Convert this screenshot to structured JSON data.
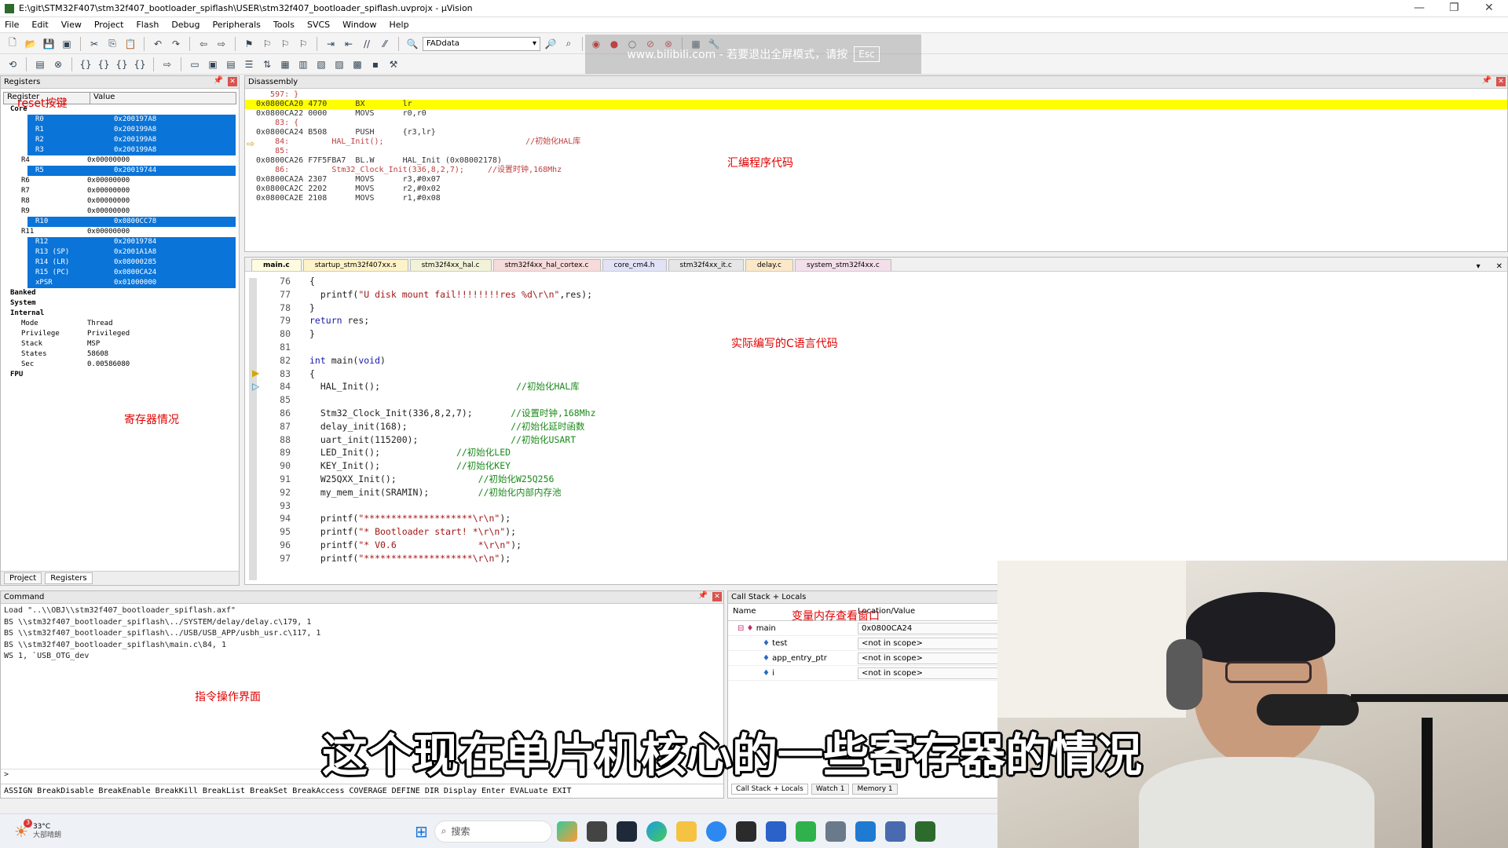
{
  "window": {
    "title": "E:\\git\\STM32F407\\stm32f407_bootloader_spiflash\\USER\\stm32f407_bootloader_spiflash.uvprojx - µVision"
  },
  "menu": [
    "File",
    "Edit",
    "View",
    "Project",
    "Flash",
    "Debug",
    "Peripherals",
    "Tools",
    "SVCS",
    "Window",
    "Help"
  ],
  "toolbar": {
    "combo_value": "FADdata"
  },
  "banner": {
    "text": "www.bilibili.com - 若要退出全屏模式，请按",
    "key": "Esc"
  },
  "registers": {
    "title": "Registers",
    "col_register": "Register",
    "col_value": "Value",
    "rows": [
      {
        "name": "Core",
        "value": "",
        "kind": "top"
      },
      {
        "name": "R0",
        "value": "0x200197A8",
        "kind": "sel"
      },
      {
        "name": "R1",
        "value": "0x200199A8",
        "kind": "sel"
      },
      {
        "name": "R2",
        "value": "0x200199A8",
        "kind": "sel"
      },
      {
        "name": "R3",
        "value": "0x200199A8",
        "kind": "sel"
      },
      {
        "name": "R4",
        "value": "0x00000000",
        "kind": "reg"
      },
      {
        "name": "R5",
        "value": "0x20019744",
        "kind": "sel"
      },
      {
        "name": "R6",
        "value": "0x00000000",
        "kind": "reg"
      },
      {
        "name": "R7",
        "value": "0x00000000",
        "kind": "reg"
      },
      {
        "name": "R8",
        "value": "0x00000000",
        "kind": "reg"
      },
      {
        "name": "R9",
        "value": "0x00000000",
        "kind": "reg"
      },
      {
        "name": "R10",
        "value": "0x0800CC78",
        "kind": "sel"
      },
      {
        "name": "R11",
        "value": "0x00000000",
        "kind": "reg"
      },
      {
        "name": "R12",
        "value": "0x20019784",
        "kind": "sel"
      },
      {
        "name": "R13 (SP)",
        "value": "0x2001A1A8",
        "kind": "sel"
      },
      {
        "name": "R14 (LR)",
        "value": "0x08000285",
        "kind": "sel"
      },
      {
        "name": "R15 (PC)",
        "value": "0x0800CA24",
        "kind": "sel"
      },
      {
        "name": "xPSR",
        "value": "0x01000000",
        "kind": "sel"
      },
      {
        "name": "Banked",
        "value": "",
        "kind": "top"
      },
      {
        "name": "System",
        "value": "",
        "kind": "top"
      },
      {
        "name": "Internal",
        "value": "",
        "kind": "top"
      },
      {
        "name": "Mode",
        "value": "Thread",
        "kind": "reg"
      },
      {
        "name": "Privilege",
        "value": "Privileged",
        "kind": "reg"
      },
      {
        "name": "Stack",
        "value": "MSP",
        "kind": "reg"
      },
      {
        "name": "States",
        "value": "58608",
        "kind": "reg"
      },
      {
        "name": "Sec",
        "value": "0.00586080",
        "kind": "reg"
      },
      {
        "name": "FPU",
        "value": "",
        "kind": "top"
      }
    ],
    "tabs": [
      "Project",
      "Registers"
    ]
  },
  "disasm": {
    "title": "Disassembly",
    "lines": [
      {
        "t": "   597: }",
        "k": "src"
      },
      {
        "t": "0x0800CA20 4770      BX        lr",
        "k": "hl"
      },
      {
        "t": "0x0800CA22 0000      MOVS      r0,r0",
        "k": "asm"
      },
      {
        "t": "    83: {",
        "k": "src"
      },
      {
        "t": "0x0800CA24 B508      PUSH      {r3,lr}",
        "k": "asm"
      },
      {
        "t": "    84:         HAL_Init();                              //初始化HAL库",
        "k": "src"
      },
      {
        "t": "    85:",
        "k": "src"
      },
      {
        "t": "0x0800CA26 F7F5FBA7  BL.W      HAL_Init (0x08002178)",
        "k": "asm"
      },
      {
        "t": "    86:         Stm32_Clock_Init(336,8,2,7);     //设置时钟,168Mhz",
        "k": "src"
      },
      {
        "t": "0x0800CA2A 2307      MOVS      r3,#0x07",
        "k": "asm"
      },
      {
        "t": "0x0800CA2C 2202      MOVS      r2,#0x02",
        "k": "asm"
      },
      {
        "t": "0x0800CA2E 2108      MOVS      r1,#0x08",
        "k": "asm"
      }
    ]
  },
  "editor": {
    "tabs": [
      "main.c",
      "startup_stm32f407xx.s",
      "stm32f4xx_hal.c",
      "stm32f4xx_hal_cortex.c",
      "core_cm4.h",
      "stm32f4xx_it.c",
      "delay.c",
      "system_stm32f4xx.c"
    ],
    "lines": [
      {
        "n": "76",
        "c": "{"
      },
      {
        "n": "77",
        "c": "  printf(\"U disk mount fail!!!!!!!!res %d\\r\\n\",res);"
      },
      {
        "n": "78",
        "c": "}"
      },
      {
        "n": "79",
        "c": "return res;"
      },
      {
        "n": "80",
        "c": "}"
      },
      {
        "n": "81",
        "c": ""
      },
      {
        "n": "82",
        "c": "int main(void)"
      },
      {
        "n": "83",
        "c": "{"
      },
      {
        "n": "84",
        "c": "  HAL_Init();                         //初始化HAL库"
      },
      {
        "n": "85",
        "c": ""
      },
      {
        "n": "86",
        "c": "  Stm32_Clock_Init(336,8,2,7);       //设置时钟,168Mhz"
      },
      {
        "n": "87",
        "c": "  delay_init(168);                   //初始化延时函数"
      },
      {
        "n": "88",
        "c": "  uart_init(115200);                 //初始化USART"
      },
      {
        "n": "89",
        "c": "  LED_Init();              //初始化LED"
      },
      {
        "n": "90",
        "c": "  KEY_Init();              //初始化KEY"
      },
      {
        "n": "91",
        "c": "  W25QXX_Init();               //初始化W25Q256"
      },
      {
        "n": "92",
        "c": "  my_mem_init(SRAMIN);         //初始化内部内存池"
      },
      {
        "n": "93",
        "c": ""
      },
      {
        "n": "94",
        "c": "  printf(\"********************\\r\\n\");"
      },
      {
        "n": "95",
        "c": "  printf(\"* Bootloader start! *\\r\\n\");"
      },
      {
        "n": "96",
        "c": "  printf(\"* V0.6               *\\r\\n\");"
      },
      {
        "n": "97",
        "c": "  printf(\"********************\\r\\n\");"
      }
    ]
  },
  "command": {
    "title": "Command",
    "lines": [
      "Load \"..\\\\OBJ\\\\stm32f407_bootloader_spiflash.axf\"",
      "BS \\\\stm32f407_bootloader_spiflash\\../SYSTEM/delay/delay.c\\179, 1",
      "BS \\\\stm32f407_bootloader_spiflash\\../USB/USB_APP/usbh_usr.c\\117, 1",
      "BS \\\\stm32f407_bootloader_spiflash\\main.c\\84, 1",
      "WS 1, `USB_OTG_dev"
    ],
    "prompt": ">",
    "hints": "ASSIGN BreakDisable BreakEnable BreakKill BreakList BreakSet BreakAccess COVERAGE DEFINE DIR Display Enter EVALuate EXIT"
  },
  "callstack": {
    "title": "Call Stack + Locals",
    "col_name": "Name",
    "col_value": "Location/Value",
    "rows": [
      {
        "name": "main",
        "value": "0x0800CA24"
      },
      {
        "name": "test",
        "value": "<not in scope>"
      },
      {
        "name": "app_entry_ptr",
        "value": "<not in scope>"
      },
      {
        "name": "i",
        "value": "<not in scope>"
      }
    ],
    "tabs": [
      "Call Stack + Locals",
      "Watch 1",
      "Memory 1"
    ]
  },
  "taskbar": {
    "temp": "33°C",
    "weather": "大部晴朗",
    "search": "搜索",
    "badge": "3"
  },
  "annotations": {
    "reset": "reset按键",
    "asm": "汇编程序代码",
    "c_code": "实际编写的C语言代码",
    "registers": "寄存器情况",
    "memory": "变量内存查看窗口",
    "command": "指令操作界面"
  },
  "subtitle": "这个现在单片机核心的一些寄存器的情况"
}
